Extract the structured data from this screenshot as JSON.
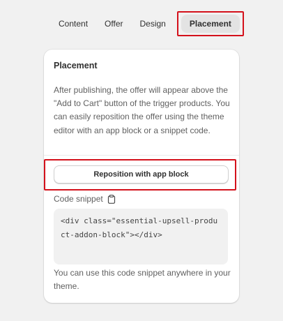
{
  "tabs": [
    {
      "label": "Content"
    },
    {
      "label": "Offer"
    },
    {
      "label": "Design"
    },
    {
      "label": "Placement",
      "active": true
    }
  ],
  "card": {
    "title": "Placement",
    "description": "After publishing, the offer will appear above the \"Add to Cart\" button of the trigger products. You can easily reposition the offer using the theme editor with an app block or a snippet code.",
    "reposition_button": "Reposition with app block",
    "snippet_label": "Code snippet",
    "snippet_icon": "clipboard-icon",
    "code": "<div class=\"essential-upsell-product-addon-block\"></div>",
    "footer": "You can use this code snippet anywhere in your theme."
  },
  "colors": {
    "highlight": "#d4111b",
    "background": "#f1f1f1",
    "active_tab_bg": "#e3e3e3"
  }
}
